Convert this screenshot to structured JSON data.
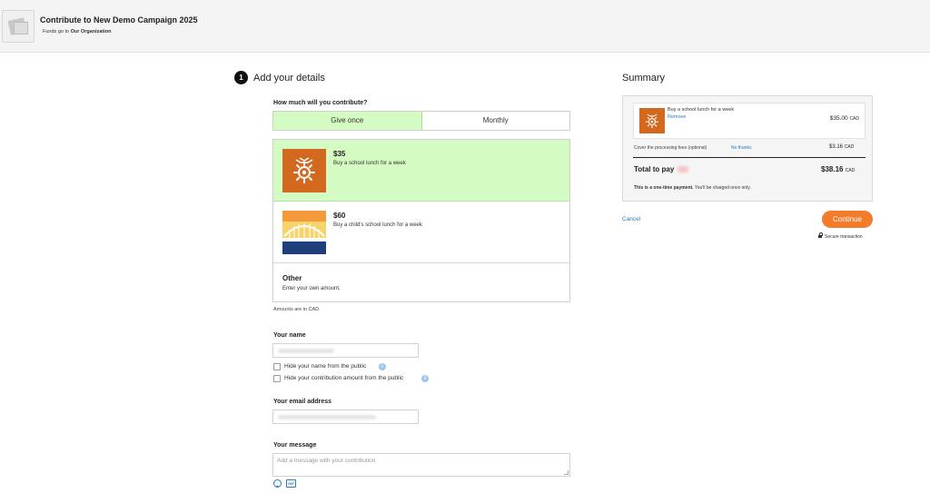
{
  "header": {
    "campaign_title": "Contribute to New Demo Campaign 2025",
    "funds_prefix": "Funds go to ",
    "organization": "Our Organization",
    "logo_icon": "campaign-image-placeholder-icon"
  },
  "step": {
    "number": "1",
    "title": "Add your details"
  },
  "contribution": {
    "question": "How much will you contribute?",
    "frequency": {
      "once": "Give once",
      "monthly": "Monthly",
      "selected": "Give once"
    },
    "options": [
      {
        "amount": "$35",
        "description": "Buy a school lunch for a week",
        "selected": true,
        "icon": "school-lunch-sun-icon"
      },
      {
        "amount": "$60",
        "description": "Buy a child's school lunch for a week",
        "selected": false,
        "icon": "bridge-illustration-icon"
      },
      {
        "amount": "Other",
        "description": "Enter your own amount.",
        "selected": false
      }
    ],
    "note": "Amounts are in CAD."
  },
  "form": {
    "name_label": "Your name",
    "hide_name_label": "Hide your name from the public",
    "hide_amount_label": "Hide your contribution amount from the public",
    "email_label": "Your email address",
    "message_label": "Your message",
    "message_placeholder": "Add a message with your contribution",
    "gif_label": "GIF"
  },
  "summary": {
    "title": "Summary",
    "item_name": "Buy a school lunch for a week",
    "remove_label": "Remove",
    "item_price": "$35.00",
    "currency": "CAD",
    "fees_label": "Cover the processing fees (optional)",
    "no_thanks_label": "No thanks",
    "fees_amount": "$3.16",
    "total_label": "Total to pay",
    "total_amount": "$38.16",
    "one_time_bold": "This is a one-time payment.",
    "one_time_rest": " You'll be charged once only."
  },
  "actions": {
    "cancel_label": "Cancel",
    "continue_label": "Continue",
    "secure_label": "Secure transaction"
  },
  "colors": {
    "selected_green": "#d4fbc1",
    "accent_orange": "#f47b2a",
    "link_blue": "#2a7bb9",
    "tile_orange": "#d2691e"
  }
}
